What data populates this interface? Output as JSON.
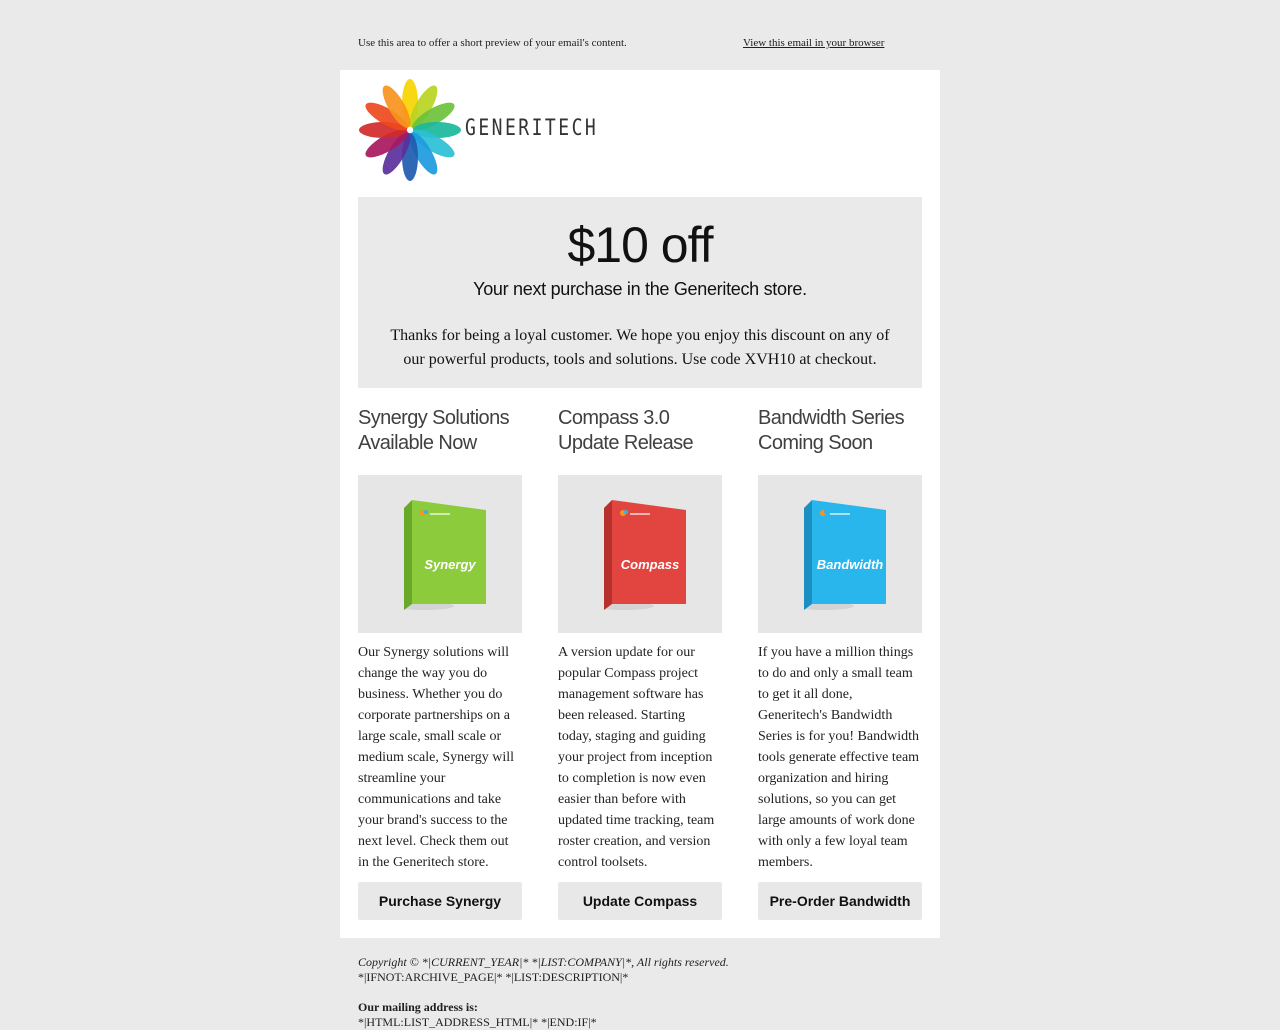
{
  "preheader": {
    "text": "Use this area to offer a short preview of your email's content.",
    "view_link": "View this email in your browser"
  },
  "brand": {
    "name": "GENERITECH",
    "petal_colors": [
      "#f7d400",
      "#b9d421",
      "#6cc13b",
      "#1ab99b",
      "#2bbfd6",
      "#1d9be0",
      "#1f5bb0",
      "#5b2f9a",
      "#a8185e",
      "#d12a2a",
      "#ee4a1c",
      "#f7941d"
    ]
  },
  "promo": {
    "headline": "$10 off",
    "subhead": "Your next purchase in the Generitech store.",
    "body": "Thanks for being a loyal customer. We hope you enjoy this discount on any of our powerful products, tools and solutions. Use code XVH10 at checkout."
  },
  "products": [
    {
      "title_line1": "Synergy Solutions",
      "title_line2": "Available Now",
      "box_label": "Synergy",
      "color": "#8ccc3c",
      "dark": "#6aa82a",
      "body": "Our Synergy solutions will change the way you do business. Whether you do corporate partnerships on a large scale, small scale or medium scale, Synergy will streamline your communications and take your brand's success to the next level. Check them out in the Generitech store.",
      "button": "Purchase Synergy"
    },
    {
      "title_line1": "Compass 3.0",
      "title_line2": "Update Release",
      "box_label": "Compass",
      "color": "#e2453f",
      "dark": "#b8302c",
      "body": "A version update for our popular Compass project management software has been released. Starting today, staging and guiding your project from inception to completion is now even easier than before with updated time tracking, team roster creation, and version control toolsets.",
      "button": "Update Compass"
    },
    {
      "title_line1": "Bandwidth Series",
      "title_line2": "Coming Soon",
      "box_label": "Bandwidth",
      "color": "#29b6ec",
      "dark": "#1b8fc2",
      "body": "If you have a million things to do and only a small team to get it all done, Generitech's Bandwidth Series is for you! Bandwidth tools generate effective team organization and hiring solutions, so you can get large amounts of work done with only a few loyal team members.",
      "button": "Pre-Order Bandwidth"
    }
  ],
  "footer": {
    "copyright": "Copyright © *|CURRENT_YEAR|* *|LIST:COMPANY|*, All rights reserved.",
    "line2": "*|IFNOT:ARCHIVE_PAGE|* *|LIST:DESCRIPTION|*",
    "mailing_label": "Our mailing address is:",
    "address": "*|HTML:LIST_ADDRESS_HTML|* *|END:IF|*"
  }
}
